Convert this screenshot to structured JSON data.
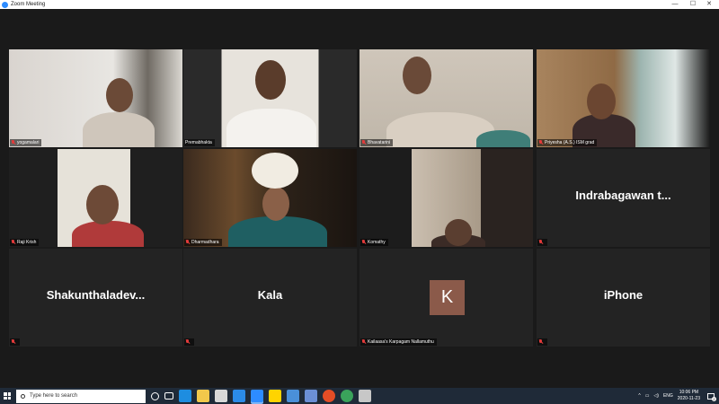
{
  "window": {
    "title": "Zoom Meeting",
    "controls": {
      "minimize": "—",
      "maximize": "☐",
      "close": "✕"
    }
  },
  "participants": [
    {
      "name": "yogamalari",
      "video": true,
      "muted": true
    },
    {
      "name": "Premabhakta",
      "video": true,
      "muted": false,
      "active_speaker": true
    },
    {
      "name": "Bhavatarini",
      "video": true,
      "muted": true
    },
    {
      "name": "Priyesha (A.S.) ISM grad",
      "video": true,
      "muted": true
    },
    {
      "name": "Raji Krish",
      "video": true,
      "muted": true
    },
    {
      "name": "Dharmadhara",
      "video": true,
      "muted": true
    },
    {
      "name": "Komathy",
      "video": true,
      "muted": true
    },
    {
      "name": "Indrabagawan t...",
      "display_name": "Indrabagawan t...",
      "video": false,
      "muted": true
    },
    {
      "name": "Shakunthaladev...",
      "display_name": "Shakunthaladev...",
      "video": false,
      "muted": true
    },
    {
      "name": "Kala",
      "display_name": "Kala",
      "video": false,
      "muted": true
    },
    {
      "name": "Kailaasa's Karpagam Nallamuthu",
      "avatar_letter": "K",
      "video": false,
      "muted": true
    },
    {
      "name": "iPhone",
      "display_name": "iPhone",
      "video": false,
      "muted": true
    }
  ],
  "taskbar": {
    "search_placeholder": "Type here to search",
    "tray_language": "ENG",
    "time": "10:06 PM",
    "date": "2020-11-23",
    "notification_count": "2"
  },
  "colors": {
    "active_speaker_border": "#c9e86b",
    "mute_icon": "#e23b3b",
    "tile_background": "#232323",
    "avatar_background": "#8b5a4a",
    "taskbar": "#1f2a38"
  }
}
